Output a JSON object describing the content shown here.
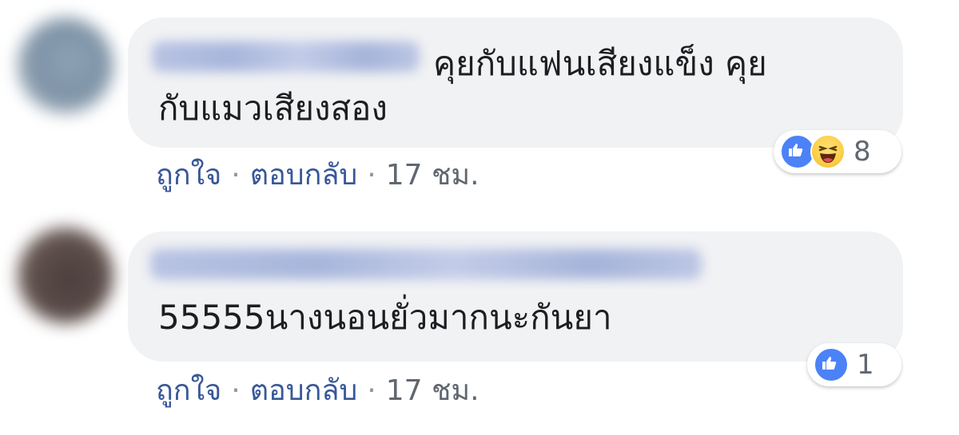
{
  "comments": [
    {
      "text_lines": [
        "คุยกับแฟนเสียงแข็ง คุย",
        "กับแมวเสียงสอง"
      ],
      "reactions": {
        "icons": [
          "like-icon",
          "haha-icon"
        ],
        "count": "8"
      },
      "actions": {
        "like": "ถูกใจ",
        "reply": "ตอบกลับ",
        "separator": "·",
        "time": "17 ชม."
      }
    },
    {
      "text_lines": [
        "55555นางนอนยั่วมากนะกันยา"
      ],
      "reactions": {
        "icons": [
          "like-icon"
        ],
        "count": "1"
      },
      "actions": {
        "like": "ถูกใจ",
        "reply": "ตอบกลับ",
        "separator": "·",
        "time": "17 ชม."
      }
    }
  ],
  "colors": {
    "bubble": "#f1f2f4",
    "link": "#385898",
    "meta": "#606770",
    "like": "#4c82f7"
  }
}
